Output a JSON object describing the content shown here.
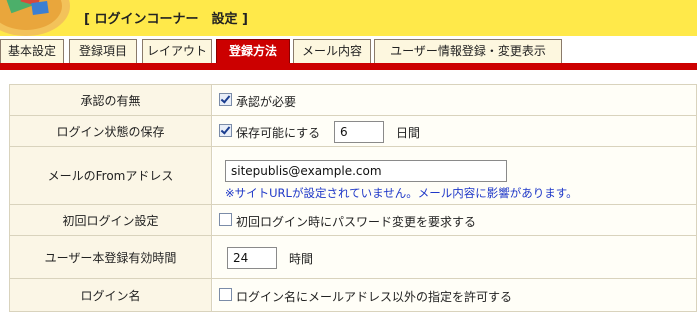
{
  "header": {
    "title": "[ ログインコーナー　設定 ]"
  },
  "tabs": [
    {
      "label": "基本設定",
      "active": false
    },
    {
      "label": "登録項目",
      "active": false
    },
    {
      "label": "レイアウト",
      "active": false
    },
    {
      "label": "登録方法",
      "active": true
    },
    {
      "label": "メール内容",
      "active": false
    },
    {
      "label": "ユーザー情報登録・変更表示",
      "active": false
    }
  ],
  "settings": {
    "approval": {
      "label": "承認の有無",
      "checkbox_label": "承認が必要",
      "checked": true
    },
    "save_login": {
      "label": "ログイン状態の保存",
      "checkbox_label": "保存可能にする",
      "checked": true,
      "days_value": "6",
      "days_unit": "日間"
    },
    "mail_from": {
      "label": "メールのFromアドレス",
      "value": "sitepublis@example.com",
      "warning": "※サイトURLが設定されていません。メール内容に影響があります。"
    },
    "first_login": {
      "label": "初回ログイン設定",
      "checkbox_label": "初回ログイン時にパスワード変更を要求する",
      "checked": false
    },
    "expiry": {
      "label": "ユーザー本登録有効時間",
      "value": "24",
      "unit": "時間"
    },
    "login_name": {
      "label": "ログイン名",
      "checkbox_label": "ログイン名にメールアドレス以外の指定を許可する",
      "checked": false
    }
  },
  "colors": {
    "header_bg": "#ffe94a",
    "accent": "#cc0000",
    "label_bg": "#fbf6e6",
    "note": "#1f38c8"
  }
}
